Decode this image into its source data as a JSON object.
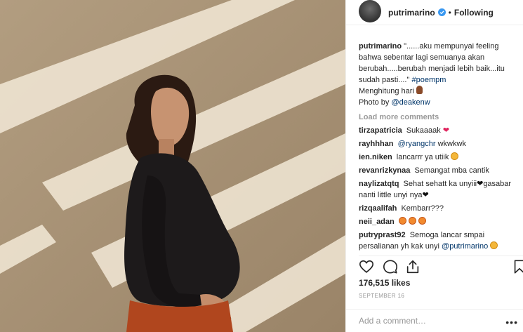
{
  "post": {
    "username": "putrimarino",
    "verified": true,
    "separator": "•",
    "follow_status": "Following"
  },
  "caption": {
    "username": "putrimarino",
    "text": "\"......aku mempunyai feeling bahwa sebentar lagi semuanya akan berubah.....berubah menjadi lebih baik...itu sudah pasti....\"",
    "hashtag": "#poempm",
    "line2": "Menghitung hari",
    "photo_prefix": "Photo by",
    "photo_credit": "@deakenw"
  },
  "load_more": "Load more comments",
  "comments": [
    {
      "user": "tirzapatricia",
      "text": "Sukaaaak",
      "emoji": "red-heart"
    },
    {
      "user": "rayhhhan",
      "mention": "@ryangchr",
      "text": "wkwkwk"
    },
    {
      "user": "ien.niken",
      "text": "lancarrr ya utiik",
      "emoji": "grin-face"
    },
    {
      "user": "revanrizkynaa",
      "text": "Semangat mba cantik"
    },
    {
      "user": "naylizatqtq",
      "text": "Sehat sehatt ka unyiii",
      "text2": "gasabar nanti little unyi nya"
    },
    {
      "user": "rizqaalifah",
      "text": "Kembarr???"
    },
    {
      "user": "neii_adan",
      "text": ""
    },
    {
      "user": "putryprast92",
      "text": "Semoga lancar smpai persalianan yh kak unyi",
      "mention": "@putrimarino"
    }
  ],
  "likes": "176,515 likes",
  "date": "SEPTEMBER 16",
  "add_comment_placeholder": "Add a comment…",
  "more_label": "•••",
  "icons": [
    "heart-icon",
    "comment-icon",
    "share-icon",
    "bookmark-icon"
  ],
  "colors": {
    "link": "#003569",
    "muted": "#999999",
    "verified": "#3897f0",
    "heart": "#e0245e"
  }
}
